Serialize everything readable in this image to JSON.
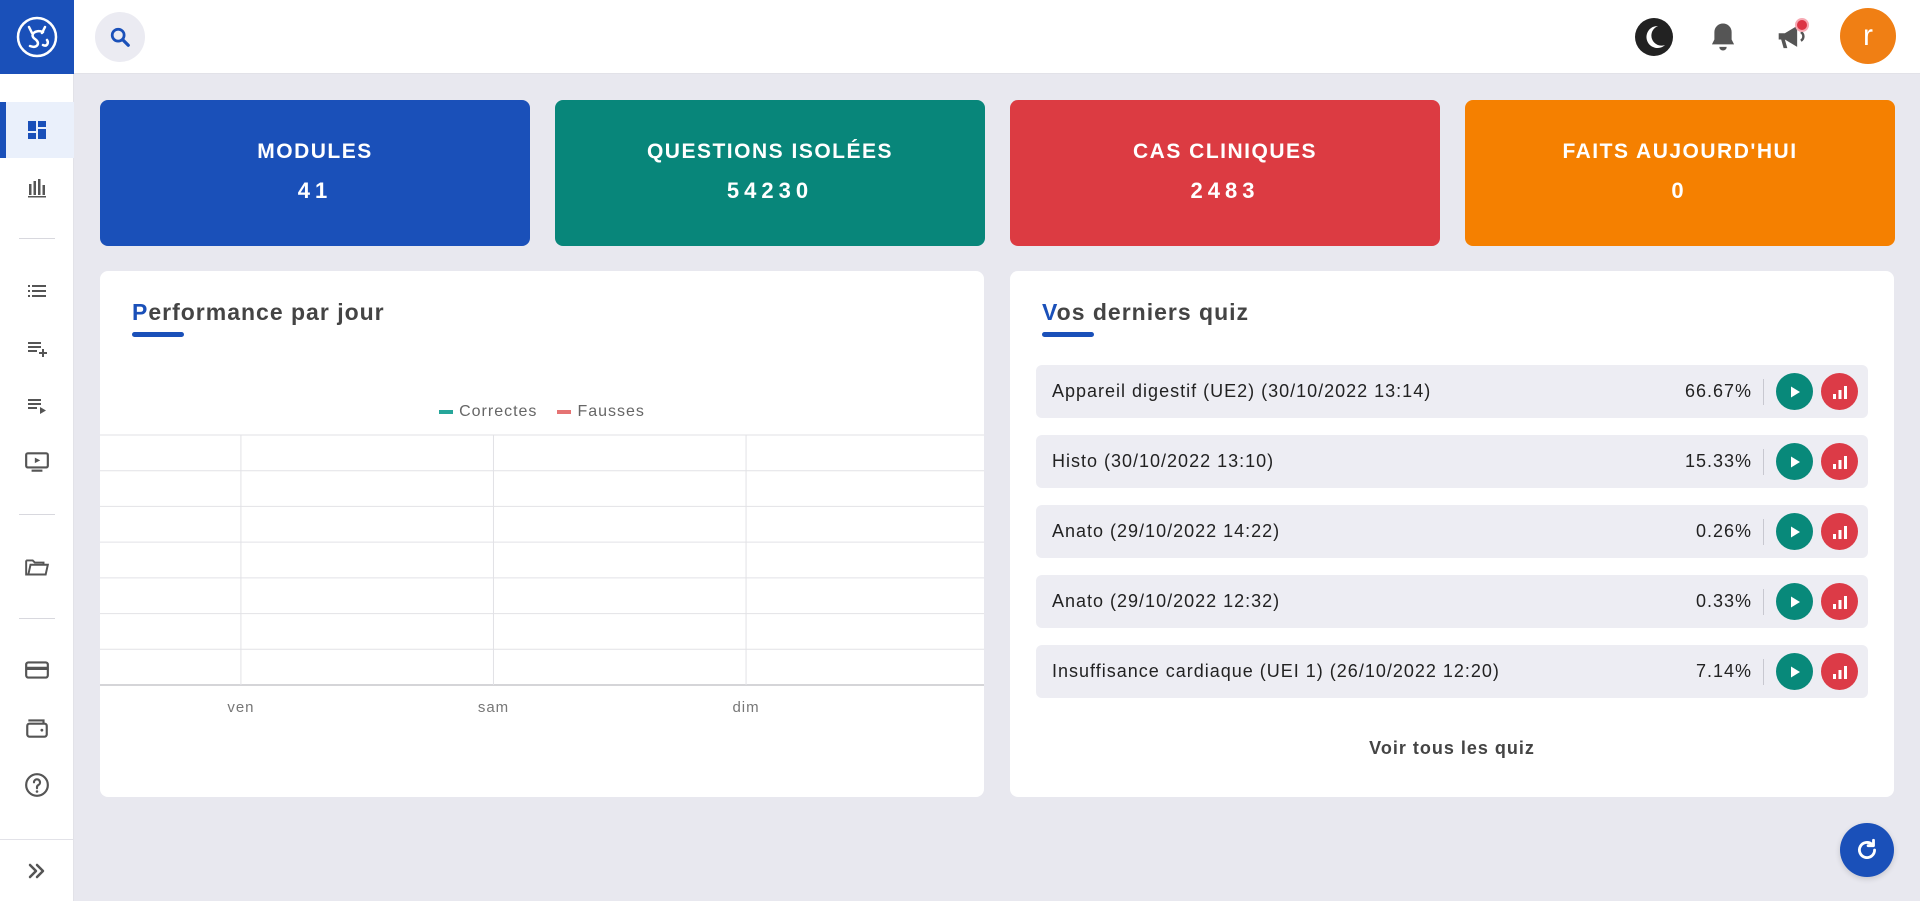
{
  "colors": {
    "primary": "#1a50b9",
    "teal": "#08897a",
    "red": "#dc3b47",
    "orange": "#f58000",
    "background": "#e8e8ef"
  },
  "sidebar": {
    "items": [
      {
        "icon": "dashboard-icon",
        "active": true
      },
      {
        "icon": "bar-chart-icon"
      },
      {
        "icon": "list-icon"
      },
      {
        "icon": "playlist-add-icon"
      },
      {
        "icon": "playlist-play-icon"
      },
      {
        "icon": "video-screen-icon"
      },
      {
        "icon": "folders-icon"
      },
      {
        "icon": "credit-card-icon"
      },
      {
        "icon": "wallet-icon"
      },
      {
        "icon": "help-circle-icon"
      }
    ],
    "expand_icon": "double-chevron-right-icon"
  },
  "topbar": {
    "avatar_letter": "r"
  },
  "stats": [
    {
      "label": "MODULES",
      "value": "41",
      "color": "#1a50b9"
    },
    {
      "label": "QUESTIONS ISOLÉES",
      "value": "54230",
      "color": "#08867a"
    },
    {
      "label": "CAS CLINIQUES",
      "value": "2483",
      "color": "#dc3b42"
    },
    {
      "label": "FAITS AUJOURD'HUI",
      "value": "0",
      "color": "#f58000"
    }
  ],
  "performance": {
    "title_first": "P",
    "title_rest": "erformance par jour"
  },
  "chart_data": {
    "type": "bar",
    "categories": [
      "ven",
      "sam",
      "dim"
    ],
    "series": [
      {
        "name": "Correctes",
        "color": "#26a69a",
        "values": [
          0,
          0,
          0
        ]
      },
      {
        "name": "Fausses",
        "color": "#e57373",
        "values": [
          0,
          0,
          0
        ]
      }
    ],
    "title": "",
    "xlabel": "",
    "ylabel": "",
    "grid": true,
    "legend": "top-center"
  },
  "quizzes": {
    "title_first": "V",
    "title_rest": "os derniers quiz",
    "items": [
      {
        "name": "Appareil digestif (UE2) (30/10/2022 13:14)",
        "score": "66.67%"
      },
      {
        "name": "Histo (30/10/2022 13:10)",
        "score": "15.33%"
      },
      {
        "name": "Anato (29/10/2022 14:22)",
        "score": "0.26%"
      },
      {
        "name": "Anato (29/10/2022 12:32)",
        "score": "0.33%"
      },
      {
        "name": "Insuffisance cardiaque (UEI 1) (26/10/2022 12:20)",
        "score": "7.14%"
      }
    ],
    "see_all": "Voir tous les quiz"
  }
}
